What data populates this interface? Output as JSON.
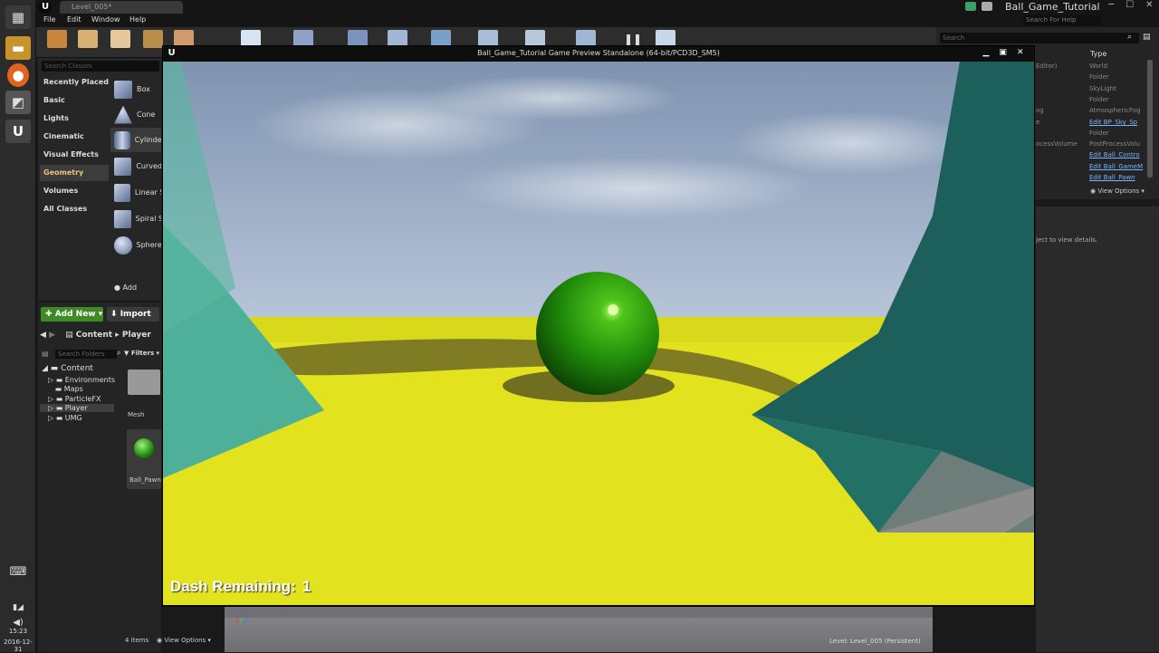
{
  "app": {
    "level_tab": "Level_005*",
    "project_name": "Ball_Game_Tutorial",
    "search_help_placeholder": "Search For Help"
  },
  "menu": [
    "File",
    "Edit",
    "Window",
    "Help"
  ],
  "modes": {
    "search_placeholder": "Search Classes",
    "categories": [
      {
        "label": "Recently Placed",
        "active": false
      },
      {
        "label": "Basic",
        "active": false
      },
      {
        "label": "Lights",
        "active": false
      },
      {
        "label": "Cinematic",
        "active": false
      },
      {
        "label": "Visual Effects",
        "active": false
      },
      {
        "label": "Geometry",
        "active": true
      },
      {
        "label": "Volumes",
        "active": false
      },
      {
        "label": "All Classes",
        "active": false
      }
    ],
    "geometry_items": [
      "Box",
      "Cone",
      "Cylinder",
      "Curved",
      "Linear S",
      "Spiral S",
      "Sphere"
    ],
    "add_label": "Add"
  },
  "content_browser": {
    "add_new": "Add New",
    "import": "Import",
    "path_root": "Content",
    "path_current": "Player",
    "folder_search_placeholder": "Search Folders",
    "filters": "Filters",
    "tree_root": "Content",
    "tree_children": [
      "Environments",
      "Maps",
      "ParticleFX",
      "Player",
      "UMG"
    ],
    "selected_folder": "Player",
    "asset_folder_label": "Mesh",
    "asset_label": "Ball_Pawn",
    "items_count": "4 items",
    "view_options": "View Options"
  },
  "outliner": {
    "search_placeholder": "Search",
    "type_header": "Type",
    "rows": [
      {
        "name": "Editor)",
        "type": "World",
        "link": false
      },
      {
        "name": "",
        "type": "Folder",
        "link": false
      },
      {
        "name": "",
        "type": "SkyLight",
        "link": false
      },
      {
        "name": "",
        "type": "Folder",
        "link": false
      },
      {
        "name": "og",
        "type": "AtmosphericFog",
        "link": false
      },
      {
        "name": "e",
        "type": "Edit BP_Sky_Sp",
        "link": true
      },
      {
        "name": "",
        "type": "Folder",
        "link": false
      },
      {
        "name": "ocessVolume",
        "type": "PostProcessVolu",
        "link": false
      },
      {
        "name": "",
        "type": "Edit Ball_Contro",
        "link": true
      },
      {
        "name": "",
        "type": "Edit Ball_GameM",
        "link": true
      },
      {
        "name": "",
        "type": "Edit Ball_Pawn",
        "link": true
      }
    ],
    "view_options": "View Options"
  },
  "details": {
    "hint": "ject to view details."
  },
  "viewport": {
    "level_info": "Level:  Level_005 (Persistent)"
  },
  "preview": {
    "title": "Ball_Game_Tutorial Game Preview Standalone (64-bit/PCD3D_SM5)",
    "hud_label": "Dash Remaining:",
    "hud_value": "1"
  },
  "os": {
    "time": "15:23",
    "date": "2016-12-31"
  },
  "colors": {
    "accent_green": "#3e8a25",
    "ball_green": "#1f8a0a",
    "floor_yellow": "#e2e21e",
    "wall_teal_light": "#4fb09a",
    "wall_teal_dark": "#1d5f5a",
    "link_blue": "#7ab6ff"
  }
}
